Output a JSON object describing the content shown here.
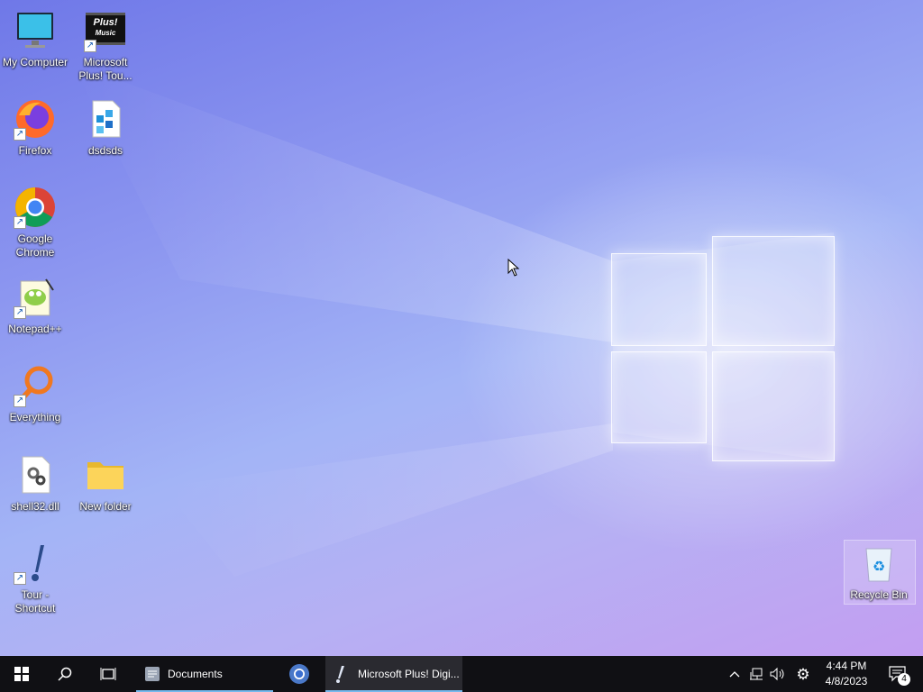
{
  "desktop_icons": [
    {
      "name": "my-computer",
      "label": "My Computer"
    },
    {
      "name": "microsoft-plus",
      "label": "Microsoft Plus! Tou..."
    },
    {
      "name": "firefox",
      "label": "Firefox"
    },
    {
      "name": "dsdsds",
      "label": "dsdsds"
    },
    {
      "name": "google-chrome",
      "label": "Google Chrome"
    },
    {
      "name": "notepad-plus-plus",
      "label": "Notepad++"
    },
    {
      "name": "everything",
      "label": "Everything"
    },
    {
      "name": "shell32",
      "label": "shell32.dll"
    },
    {
      "name": "new-folder",
      "label": "New folder"
    },
    {
      "name": "tour-shortcut",
      "label": "Tour - Shortcut"
    },
    {
      "name": "recycle-bin",
      "label": "Recycle Bin"
    }
  ],
  "plus_badge": {
    "line1": "Plus!",
    "line2": "Music"
  },
  "taskbar": {
    "apps": [
      {
        "label": "Documents"
      },
      {
        "label": "Microsoft Plus! Digi..."
      }
    ],
    "clock": {
      "time": "4:44 PM",
      "date": "4/8/2023"
    },
    "notification_count": "4"
  },
  "colors": {
    "taskbar": "#101014",
    "accent": "#76b9ed"
  }
}
